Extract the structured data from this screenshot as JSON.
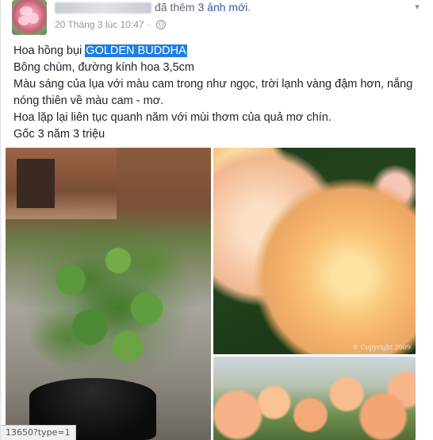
{
  "post": {
    "action_text": "đã thêm",
    "photo_count_link": "3 ảnh mới",
    "action_period": ".",
    "timestamp": "20 Tháng 3 lúc 10:47",
    "timestamp_separator": "·",
    "body": {
      "line1_prefix": "Hoa hồng bụi ",
      "line1_highlight": "GOLDEN BUDDHA",
      "line2": "Bông chùm, đường kính hoa 3,5cm",
      "line3": "Màu sáng của lụa với màu cam trong như ngọc, trời lạnh vàng đậm hơn, nắng nóng thiên về màu cam - mơ.",
      "line4": "Hoa lặp lại liên tục quanh năm với mùi thơm của quả mơ chín.",
      "line5": "Gốc 3 năm 3 triệu"
    },
    "photo_copyright": "© Copyright 2009"
  },
  "status_bar": {
    "url": "13650?type=1"
  },
  "icons": {
    "menu": "chevron-down-icon",
    "privacy": "globe-icon"
  },
  "colors": {
    "link": "#365899",
    "highlight": "#1e7fe0",
    "meta_text": "#90949c"
  }
}
